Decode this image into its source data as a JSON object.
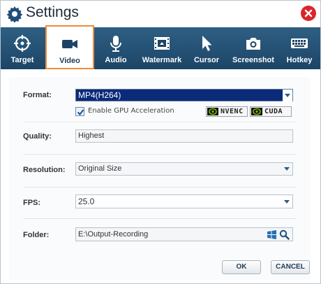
{
  "window": {
    "title": "Settings"
  },
  "toolbar": {
    "tabs": [
      {
        "label": "Target",
        "icon": "crosshair-icon",
        "active": false
      },
      {
        "label": "Video",
        "icon": "video-camera-icon",
        "active": true
      },
      {
        "label": "Audio",
        "icon": "microphone-icon",
        "active": false
      },
      {
        "label": "Watermark",
        "icon": "film-icon",
        "active": false
      },
      {
        "label": "Cursor",
        "icon": "cursor-icon",
        "active": false
      },
      {
        "label": "Screenshot",
        "icon": "camera-icon",
        "active": false
      },
      {
        "label": "Hotkey",
        "icon": "keyboard-icon",
        "active": false
      }
    ]
  },
  "form": {
    "format": {
      "label": "Format:",
      "value": "MP4(H264)"
    },
    "gpu": {
      "label": "Enable GPU Acceleration",
      "checked": true
    },
    "badges": {
      "nvenc": "NVENC",
      "cuda": "CUDA"
    },
    "quality": {
      "label": "Quality:",
      "value": "Highest"
    },
    "resolution": {
      "label": "Resolution:",
      "value": "Original Size"
    },
    "fps": {
      "label": "FPS:",
      "value": "25.0"
    },
    "folder": {
      "label": "Folder:",
      "value": "E:\\Output-Recording"
    }
  },
  "buttons": {
    "ok": "OK",
    "cancel": "CANCEL"
  },
  "colors": {
    "toolbar": "#1c4566",
    "active_tab_border": "#ef8c3a",
    "close": "#d9262b",
    "selected_field": "#0a2a7a",
    "annotation_arrow": "#c0392b"
  }
}
